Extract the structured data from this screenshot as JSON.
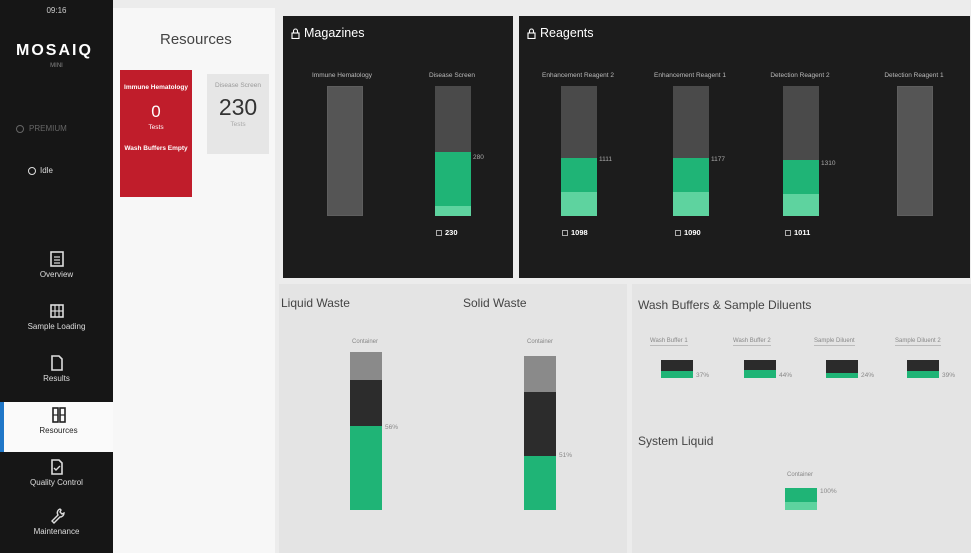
{
  "sidebar": {
    "time": "09:16",
    "logo": "MOSAIQ",
    "logo_sub": "MINI",
    "device": "PREMIUM",
    "status": "Idle",
    "items": [
      {
        "label": "Overview"
      },
      {
        "label": "Sample Loading"
      },
      {
        "label": "Results"
      },
      {
        "label": "Resources"
      },
      {
        "label": "Quality Control"
      },
      {
        "label": "Maintenance"
      }
    ],
    "active": "Resources"
  },
  "resources": {
    "title": "Resources",
    "card_red": {
      "title": "Immune Hematology",
      "count": "0",
      "unit": "Tests",
      "warning": "Wash Buffers Empty"
    },
    "card_gray": {
      "title": "Disease Screen",
      "count": "230",
      "unit": "Tests"
    }
  },
  "magazines": {
    "title": "Magazines",
    "columns": [
      {
        "label": "Immune Hematology",
        "count": "",
        "max": "",
        "fill": 0
      },
      {
        "label": "Disease Screen",
        "count": "230",
        "max": "280",
        "fill": 0.45
      }
    ]
  },
  "reagents": {
    "title": "Reagents",
    "columns": [
      {
        "label": "Enhancement Reagent 2",
        "count": "1098",
        "max": "1111",
        "fill": 0.45
      },
      {
        "label": "Enhancement Reagent 1",
        "count": "1090",
        "max": "1177",
        "fill": 0.45
      },
      {
        "label": "Detection Reagent 2",
        "count": "1011",
        "max": "1310",
        "fill": 0.43
      },
      {
        "label": "Detection Reagent 1",
        "count": "",
        "max": "",
        "fill": 0
      }
    ]
  },
  "liquid_waste": {
    "title": "Liquid Waste",
    "label": "Container",
    "pct": "56%"
  },
  "solid_waste": {
    "title": "Solid Waste",
    "label": "Container",
    "pct": "51%"
  },
  "wash": {
    "title": "Wash Buffers & Sample Diluents",
    "items": [
      {
        "label": "Wash Buffer 1",
        "pct": "37%",
        "fill": 0.37
      },
      {
        "label": "Wash Buffer 2",
        "pct": "44%",
        "fill": 0.44
      },
      {
        "label": "Sample Diluent",
        "pct": "24%",
        "fill": 0.24
      },
      {
        "label": "Sample Diluent 2",
        "pct": "39%",
        "fill": 0.39
      }
    ]
  },
  "system_liquid": {
    "title": "System Liquid",
    "label": "Container",
    "pct": "100%"
  },
  "colors": {
    "accent": "#1fb476",
    "accent_light": "#5ed39f",
    "alert": "#c01d2b",
    "nav_active": "#1f77c8"
  }
}
